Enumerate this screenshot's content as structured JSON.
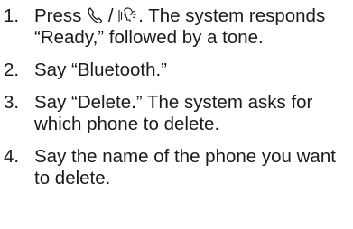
{
  "steps": [
    {
      "num": "1.",
      "lead": "Press",
      "icon_phone": "phone-icon",
      "separator": "/",
      "icon_voice": "talk-icon",
      "tail": ". The system responds “Ready,” followed by a tone."
    },
    {
      "num": "2.",
      "text": "Say “Bluetooth.”"
    },
    {
      "num": "3.",
      "text": "Say “Delete.” The system asks for which phone to delete."
    },
    {
      "num": "4.",
      "text": "Say the name of the phone you want to delete."
    }
  ]
}
